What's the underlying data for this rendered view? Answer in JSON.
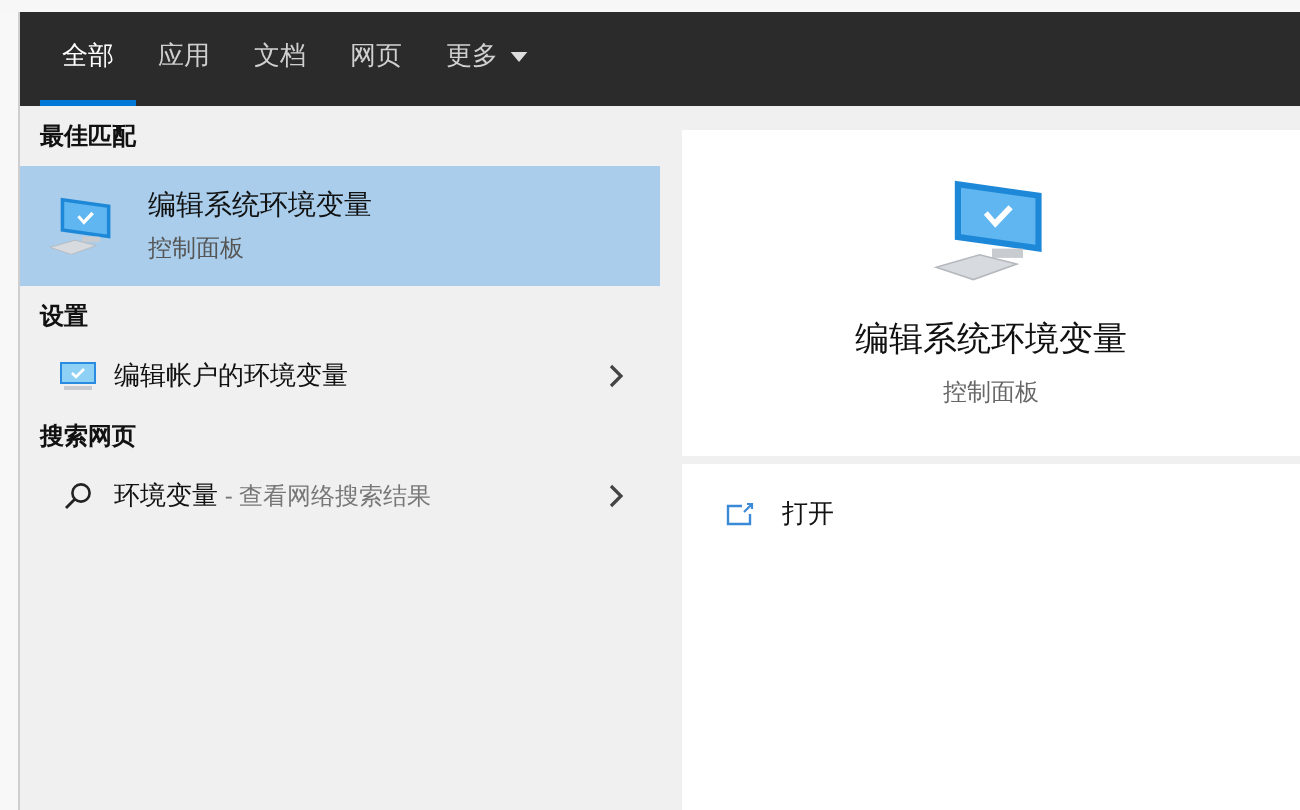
{
  "tabs": [
    {
      "label": "全部",
      "selected": true
    },
    {
      "label": "应用",
      "selected": false
    },
    {
      "label": "文档",
      "selected": false
    },
    {
      "label": "网页",
      "selected": false
    },
    {
      "label": "更多",
      "selected": false,
      "kind": "dropdown"
    }
  ],
  "results": [
    {
      "heading": "最佳匹配",
      "items": [
        {
          "kind": "best",
          "title": "编辑系统环境变量",
          "subtitle": "控制面板",
          "selected": true
        }
      ]
    },
    {
      "heading": "设置",
      "items": [
        {
          "kind": "setting",
          "title": "编辑帐户的环境变量",
          "selected": false
        }
      ]
    },
    {
      "heading": "搜索网页",
      "items": [
        {
          "kind": "web",
          "title": "环境变量",
          "suffix": " - 查看网络搜索结果",
          "selected": false
        }
      ]
    }
  ],
  "preview": {
    "title": "编辑系统环境变量",
    "subtitle": "控制面板",
    "actions": [
      {
        "label": "打开"
      }
    ]
  }
}
